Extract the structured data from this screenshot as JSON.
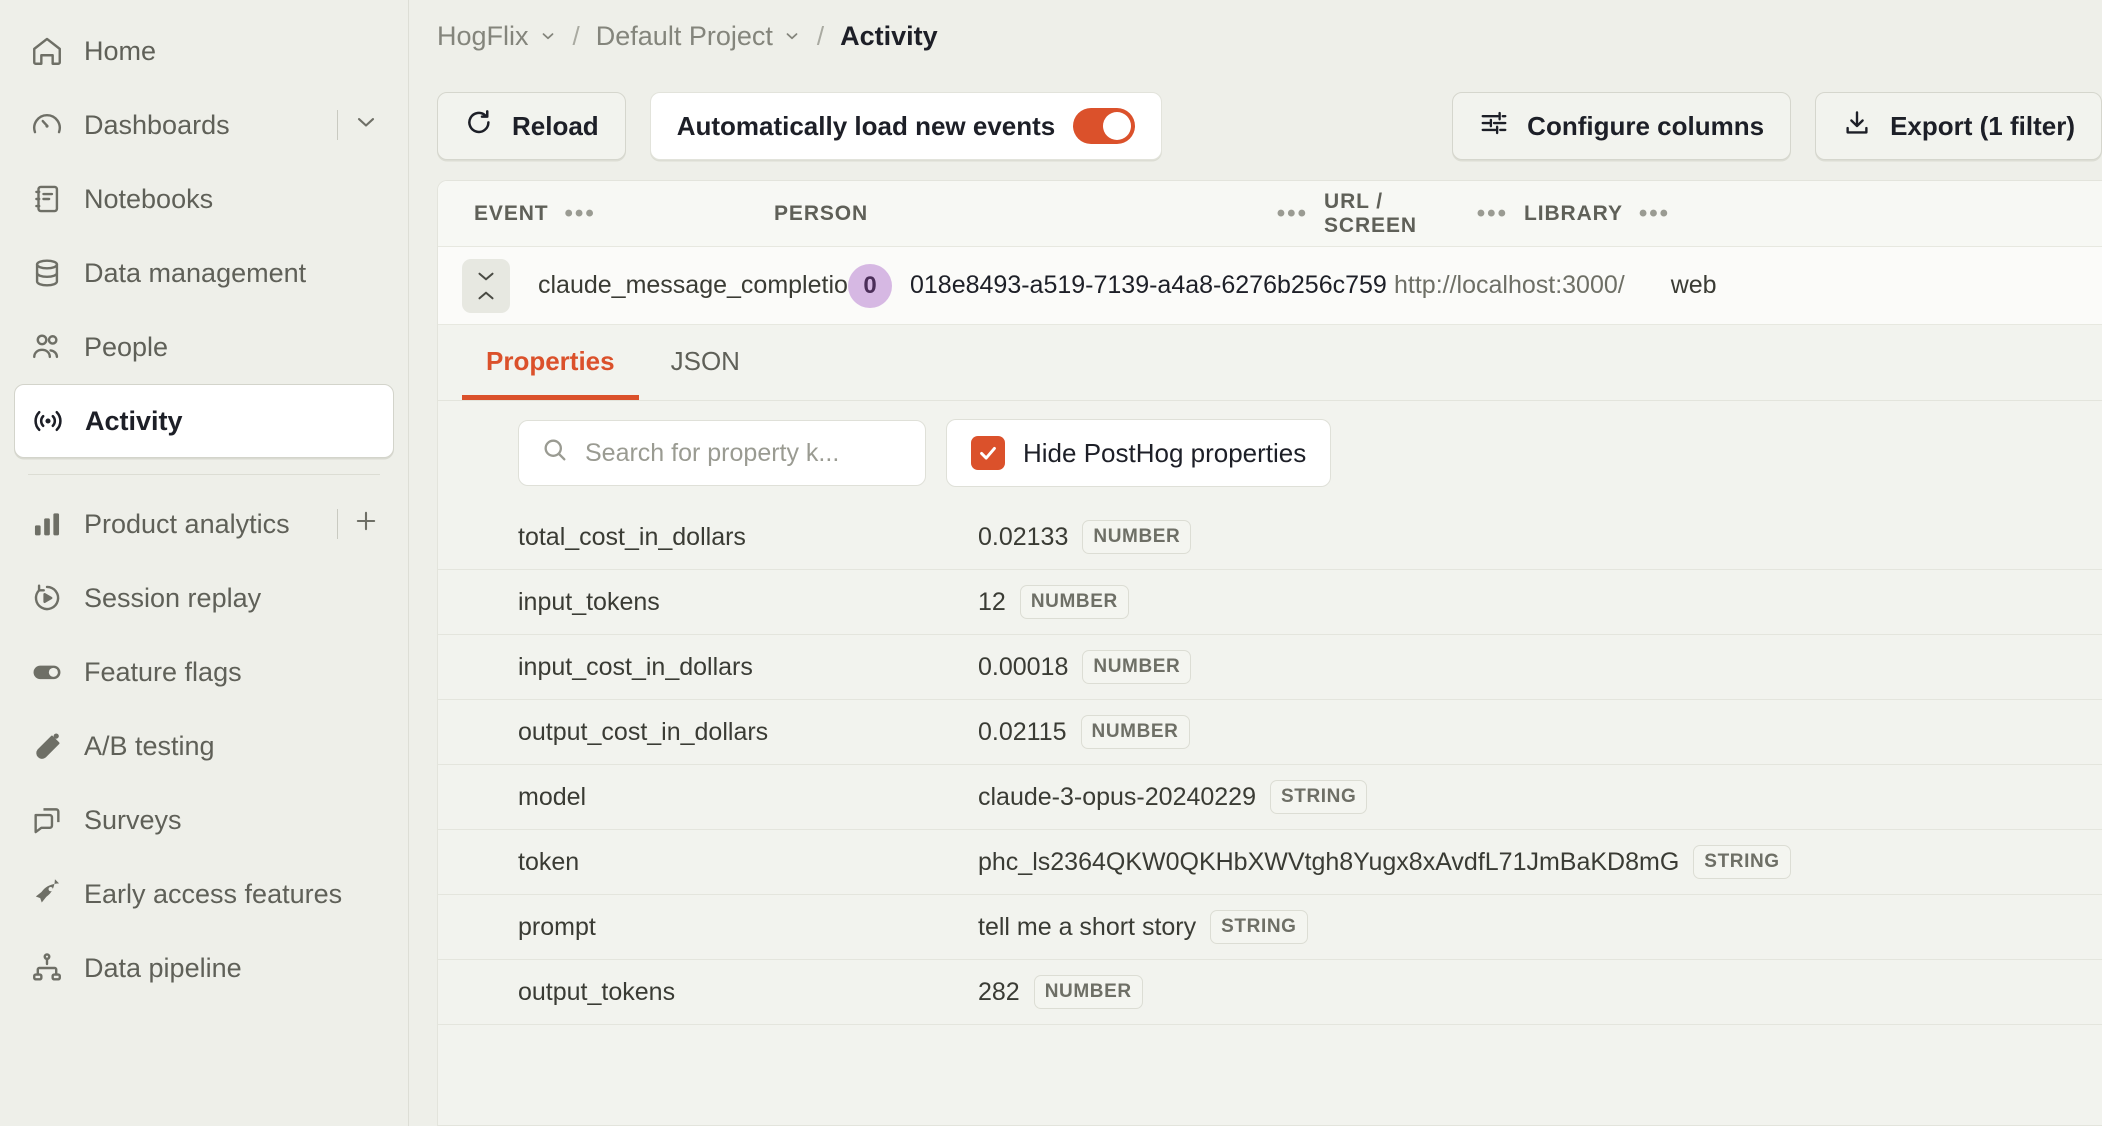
{
  "sidebar": {
    "primary_items": [
      {
        "label": "Home",
        "icon": "home-icon"
      },
      {
        "label": "Dashboards",
        "icon": "dashboard-icon",
        "has_chevron": true
      },
      {
        "label": "Notebooks",
        "icon": "notebook-icon"
      },
      {
        "label": "Data management",
        "icon": "database-icon"
      },
      {
        "label": "People",
        "icon": "people-icon"
      },
      {
        "label": "Activity",
        "icon": "activity-icon",
        "active": true
      }
    ],
    "secondary_items": [
      {
        "label": "Product analytics",
        "icon": "bar-chart-icon",
        "has_plus": true
      },
      {
        "label": "Session replay",
        "icon": "replay-icon"
      },
      {
        "label": "Feature flags",
        "icon": "toggle-icon"
      },
      {
        "label": "A/B testing",
        "icon": "flask-icon"
      },
      {
        "label": "Surveys",
        "icon": "survey-icon"
      },
      {
        "label": "Early access features",
        "icon": "rocket-icon"
      },
      {
        "label": "Data pipeline",
        "icon": "pipeline-icon"
      }
    ]
  },
  "breadcrumb": {
    "organization": "HogFlix",
    "project": "Default Project",
    "page": "Activity",
    "separator": "/"
  },
  "toolbar": {
    "reload_label": "Reload",
    "auto_load_label": "Automatically load new events",
    "auto_load_enabled": true,
    "configure_columns_label": "Configure columns",
    "export_label": "Export (1 filter)"
  },
  "events_table": {
    "columns": [
      {
        "label": "EVENT"
      },
      {
        "label": "PERSON"
      },
      {
        "label": "URL / SCREEN"
      },
      {
        "label": "LIBRARY"
      }
    ],
    "menu_glyph": "•••",
    "rows": [
      {
        "event": "claude_message_completion",
        "person_initial": "0",
        "person_id": "018e8493-a519-7139-a4a8-6276b256c759…",
        "url": "http://localhost:3000/",
        "library": "web",
        "expanded": true
      }
    ]
  },
  "detail": {
    "tabs": [
      {
        "label": "Properties",
        "active": true
      },
      {
        "label": "JSON",
        "active": false
      }
    ],
    "search": {
      "placeholder": "Search for property k...",
      "value": ""
    },
    "hide_posthog_label": "Hide PostHog properties",
    "hide_posthog_checked": true,
    "properties": [
      {
        "key": "total_cost_in_dollars",
        "value": "0.02133",
        "type": "NUMBER"
      },
      {
        "key": "input_tokens",
        "value": "12",
        "type": "NUMBER"
      },
      {
        "key": "input_cost_in_dollars",
        "value": "0.00018",
        "type": "NUMBER"
      },
      {
        "key": "output_cost_in_dollars",
        "value": "0.02115",
        "type": "NUMBER"
      },
      {
        "key": "model",
        "value": "claude-3-opus-20240229",
        "type": "STRING"
      },
      {
        "key": "token",
        "value": "phc_ls2364QKW0QKHbXWVtgh8Yugx8xAvdfL71JmBaKD8mG",
        "type": "STRING"
      },
      {
        "key": "prompt",
        "value": "tell me a short story",
        "type": "STRING"
      },
      {
        "key": "output_tokens",
        "value": "282",
        "type": "NUMBER"
      }
    ]
  },
  "colors": {
    "accent": "#DB512B",
    "page_bg": "#EEEFE9",
    "card_bg": "#FBFBF9",
    "avatar_bg": "#D6B8E3"
  }
}
